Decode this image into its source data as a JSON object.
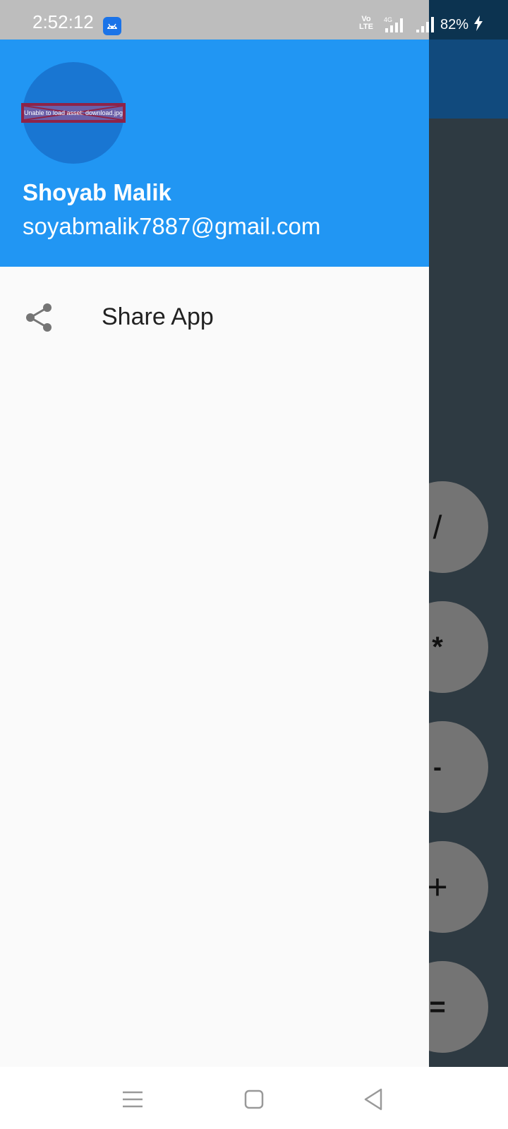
{
  "status_bar": {
    "time": "2:52:12",
    "volte": "Vo LTE",
    "network": "4G",
    "battery": "82%"
  },
  "drawer": {
    "avatar_error": "Unable to load asset: download.jpg",
    "account_name": "Shoyab Malik",
    "account_email": "soyabmalik7887@gmail.com",
    "items": [
      {
        "label": "Share App",
        "icon": "share-icon"
      }
    ]
  },
  "calculator": {
    "operators": [
      "/",
      "*",
      "-",
      "+",
      "="
    ]
  },
  "nav_bar": {
    "buttons": [
      "menu-icon",
      "home-icon",
      "back-icon"
    ]
  },
  "colors": {
    "header": "#2196f3",
    "avatar": "#1976d2",
    "drawer_bg": "#fafafa",
    "app_bg": "#2e3a42",
    "operator_button": "#747474"
  }
}
